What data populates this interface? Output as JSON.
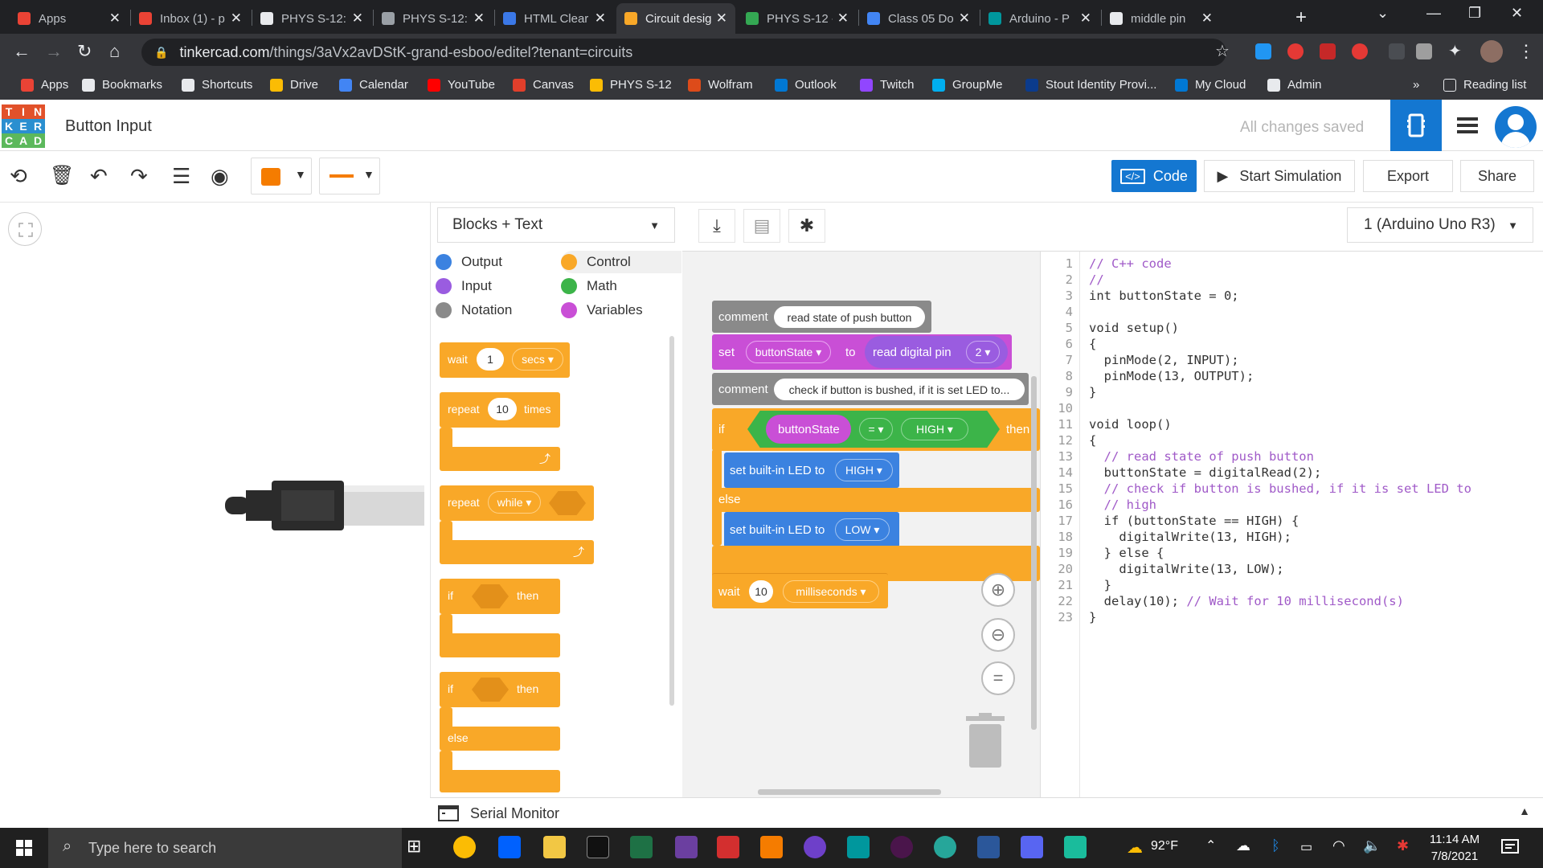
{
  "browser": {
    "tabs": [
      {
        "title": "Apps",
        "color": "#ea4335"
      },
      {
        "title": "Inbox (1) - p",
        "color": "#ea4335"
      },
      {
        "title": "PHYS S-12:",
        "color": "#e8eaed"
      },
      {
        "title": "PHYS S-12:",
        "color": "#9aa0a6"
      },
      {
        "title": "HTML Clear",
        "color": "#3b78e7"
      },
      {
        "title": "Circuit desig",
        "color": "#f9a828",
        "active": true
      },
      {
        "title": "PHYS S-12 -",
        "color": "#34a853"
      },
      {
        "title": "Class 05 Do",
        "color": "#4285f4"
      },
      {
        "title": "Arduino - P",
        "color": "#00979d"
      },
      {
        "title": "middle pin",
        "color": "#e8eaed"
      }
    ],
    "url_host": "tinkercad.com",
    "url_path": "/things/3aVx2avDStK-grand-esboo/editel?tenant=circuits",
    "bookmarks": [
      {
        "label": "Apps",
        "color": "#ea4335"
      },
      {
        "label": "Bookmarks",
        "color": "#e8eaed"
      },
      {
        "label": "Shortcuts",
        "color": "#e8eaed"
      },
      {
        "label": "Drive",
        "color": "#fbbc04"
      },
      {
        "label": "Calendar",
        "color": "#4285f4"
      },
      {
        "label": "YouTube",
        "color": "#ff0000"
      },
      {
        "label": "Canvas",
        "color": "#e13f2b"
      },
      {
        "label": "PHYS S-12",
        "color": "#fbbc04"
      },
      {
        "label": "Wolfram",
        "color": "#dd4b1a"
      },
      {
        "label": "Outlook",
        "color": "#0078d4"
      },
      {
        "label": "Twitch",
        "color": "#9146ff"
      },
      {
        "label": "GroupMe",
        "color": "#00aff0"
      },
      {
        "label": "Stout Identity Provi...",
        "color": "#0b3b8c"
      },
      {
        "label": "My Cloud",
        "color": "#0078d4"
      },
      {
        "label": "Admin",
        "color": "#e8eaed"
      }
    ],
    "overflow_label": "»",
    "reading_list": "Reading list"
  },
  "tinkercad": {
    "logo_letters": [
      "T",
      "I",
      "N",
      "K",
      "E",
      "R",
      "C",
      "A",
      "D"
    ],
    "logo_colors": [
      "#e2512a",
      "#e2512a",
      "#e2512a",
      "#2a8fd0",
      "#2a8fd0",
      "#2a8fd0",
      "#5cb85c",
      "#5cb85c",
      "#5cb85c"
    ],
    "design_title": "Button Input",
    "save_status": "All changes saved"
  },
  "toolbar": {
    "code_label": "Code",
    "start_sim_label": "Start Simulation",
    "export_label": "Export",
    "share_label": "Share",
    "fill_color": "#f57c00",
    "line_color": "#f57c00"
  },
  "palette": {
    "mode": "Blocks + Text",
    "categories": [
      {
        "label": "Output",
        "color": "#3b82e0"
      },
      {
        "label": "Control",
        "color": "#f9a828"
      },
      {
        "label": "Input",
        "color": "#9a5ce0"
      },
      {
        "label": "Math",
        "color": "#3cb449"
      },
      {
        "label": "Notation",
        "color": "#8a8a8a"
      },
      {
        "label": "Variables",
        "color": "#c94fd6"
      }
    ],
    "blocks": {
      "wait_label": "wait",
      "wait_value": "1",
      "wait_unit": "secs",
      "repeat_label": "repeat",
      "repeat_value": "10",
      "repeat_times": "times",
      "repeat_while_label": "repeat",
      "while_label": "while",
      "if_label": "if",
      "then_label": "then",
      "if2_label": "if",
      "then2_label": "then",
      "else_label": "else"
    }
  },
  "workspace": {
    "comment_label": "comment",
    "comment1": "read state of push button",
    "set_label": "set",
    "var_name": "buttonState",
    "to_label": "to",
    "read_digital": "read digital pin",
    "pin": "2",
    "comment2": "check if button is bushed, if it is set LED to...",
    "if_label": "if",
    "cond_var": "buttonState",
    "operator": "=",
    "cond_value": "HIGH",
    "then_label": "then",
    "set_led_label": "set built-in LED to",
    "led_high": "HIGH",
    "else_label": "else",
    "led_low": "LOW",
    "wait_label": "wait",
    "wait_value": "10",
    "wait_unit": "milliseconds"
  },
  "code": {
    "board": "1 (Arduino Uno R3)",
    "lines": [
      "// C++ code",
      "//",
      "int buttonState = 0;",
      "",
      "void setup()",
      "{",
      "  pinMode(2, INPUT);",
      "  pinMode(13, OUTPUT);",
      "}",
      "",
      "void loop()",
      "{",
      "  // read state of push button",
      "  buttonState = digitalRead(2);",
      "  // check if button is bushed, if it is set LED to",
      "  // high",
      "  if (buttonState == HIGH) {",
      "    digitalWrite(13, HIGH);",
      "  } else {",
      "    digitalWrite(13, LOW);",
      "  }",
      "  delay(10); // Wait for 10 millisecond(s)",
      "}"
    ]
  },
  "serial_monitor": "Serial Monitor",
  "taskbar": {
    "search_placeholder": "Type here to search",
    "weather": "92°F",
    "time": "11:14 AM",
    "date": "7/8/2021"
  }
}
